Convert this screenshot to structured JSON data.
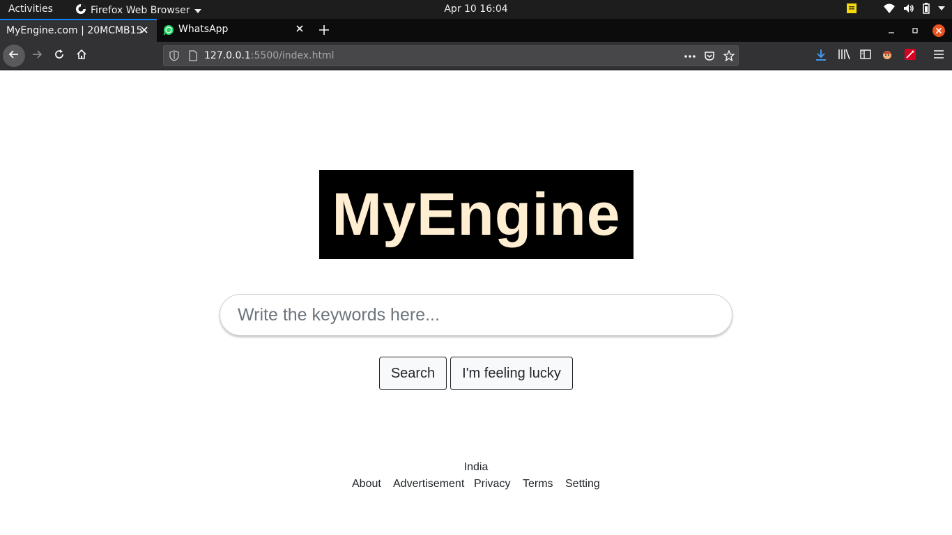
{
  "system_bar": {
    "activities": "Activities",
    "app_name": "Firefox Web Browser",
    "datetime": "Apr 10  16:04"
  },
  "tabs": [
    {
      "label": "MyEngine.com | 20MCMB15",
      "active": true
    },
    {
      "label": "WhatsApp",
      "active": false
    }
  ],
  "url": {
    "host": "127.0.0.1",
    "rest": ":5500/index.html"
  },
  "page": {
    "logo_text": "MyEngine",
    "search_placeholder": "Write the keywords here...",
    "search_button": "Search",
    "lucky_button": "I'm feeling lucky",
    "footer_country": "India",
    "footer_links": {
      "about": "About",
      "advertisement": "Advertisement",
      "privacy": "Privacy",
      "terms": "Terms",
      "setting": "Setting"
    }
  },
  "colors": {
    "logo_bg": "#000000",
    "logo_text": "#ffeed1",
    "tab_accent": "#0a84ff",
    "close_window": "#e95420"
  }
}
